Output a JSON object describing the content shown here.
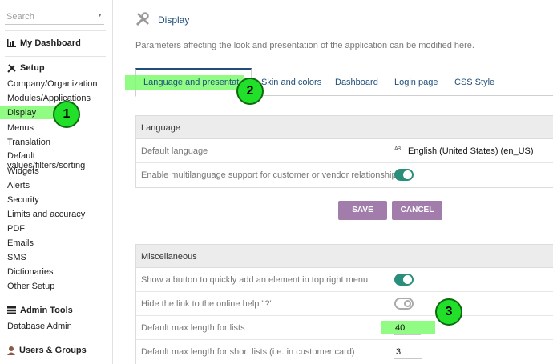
{
  "sidebar": {
    "search_placeholder": "Search",
    "my_dashboard": "My Dashboard",
    "setup": "Setup",
    "setup_items": [
      "Company/Organization",
      "Modules/Applications",
      "Display",
      "Menus",
      "Translation",
      "Default values/filters/sorting",
      "Widgets",
      "Alerts",
      "Security",
      "Limits and accuracy",
      "PDF",
      "Emails",
      "SMS",
      "Dictionaries",
      "Other Setup"
    ],
    "admin_tools": "Admin Tools",
    "admin_items": [
      "Database Admin"
    ],
    "users_groups": "Users & Groups"
  },
  "main": {
    "title": "Display",
    "description": "Parameters affecting the look and presentation of the application can be modified here.",
    "tabs": [
      "Language and presentation",
      "Skin and colors",
      "Dashboard",
      "Login page",
      "CSS Style"
    ]
  },
  "language_section": {
    "title": "Language",
    "rows": [
      {
        "label": "Default language",
        "value": "English (United States) (en_US)",
        "icon": "AB"
      },
      {
        "label": "Enable multilanguage support for customer or vendor relationships",
        "toggle": "on"
      }
    ]
  },
  "buttons": {
    "save": "SAVE",
    "cancel": "CANCEL"
  },
  "misc_section": {
    "title": "Miscellaneous",
    "rows": [
      {
        "label": "Show a button to quickly add an element in top right menu",
        "toggle": "on"
      },
      {
        "label": "Hide the link to the online help \"?\"",
        "toggle": "off"
      },
      {
        "label": "Default max length for lists",
        "value": "40"
      },
      {
        "label": "Default max length for short lists (i.e. in customer card)",
        "value": "3"
      }
    ]
  },
  "callouts": [
    "1",
    "2",
    "3"
  ],
  "colors": {
    "accent": "#1f4e79",
    "button": "#a27dac",
    "toggle_on": "#2a8f7a",
    "highlight": "#7dfc6e",
    "badge": "#22e02a"
  }
}
